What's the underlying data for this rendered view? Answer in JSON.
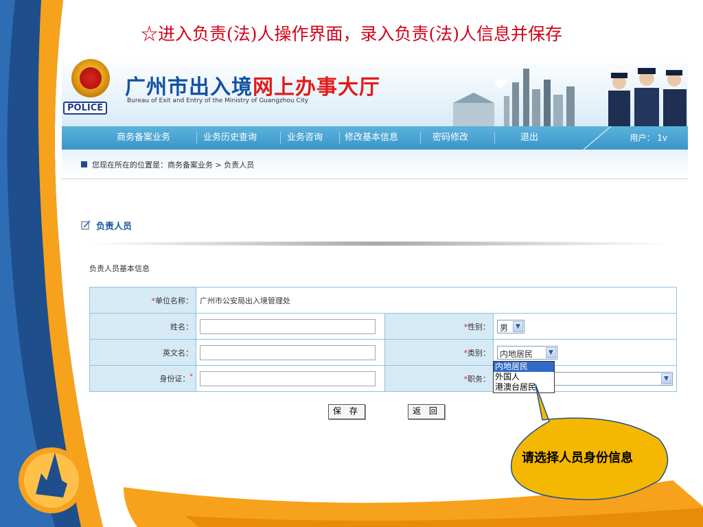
{
  "slide": {
    "title": "☆进入负责(法)人操作界面，录入负责(法)人信息并保存"
  },
  "header": {
    "title_blue": "广州市出入境",
    "title_red": "网上办事大厅",
    "subtitle": "Bureau of Exit and Entry of the Ministry of  Guangzhou City",
    "police_label": "POLICE"
  },
  "nav": {
    "items": [
      "商务备案业务",
      "业务历史查询",
      "业务咨询",
      "修改基本信息",
      "密码修改",
      "退出"
    ],
    "user": "用户： 1v"
  },
  "breadcrumb": {
    "text": "您现在所在的位置是：商务备案业务 > 负责人员"
  },
  "section": {
    "title": "负责人员",
    "subtitle": "负责人员基本信息"
  },
  "form": {
    "unit_label": "单位名称：",
    "unit_value": "广州市公安局出入境管理处",
    "name_label": "姓名：",
    "name_value": "",
    "gender_label": "性别：",
    "gender_value": "男",
    "english_name_label": "英文名：",
    "english_name_value": "",
    "category_label": "类别：",
    "category_value": "内地居民",
    "category_options": [
      "内地居民",
      "外国人",
      "港澳台居民"
    ],
    "id_label": "身份证：",
    "id_value": "",
    "duty_label": "职务：",
    "duty_value": "",
    "required_mark": "*"
  },
  "buttons": {
    "save": "保 存",
    "back": "返 回"
  },
  "callout": {
    "text": "请选择人员身份信息"
  },
  "colors": {
    "nav": "#3a95c9",
    "label_bg": "#d6eaf6",
    "title_red": "#d0021b",
    "callout_fill": "#f5b800",
    "deco_blue": "#1f4e8c",
    "deco_orange": "#f7a21c"
  }
}
